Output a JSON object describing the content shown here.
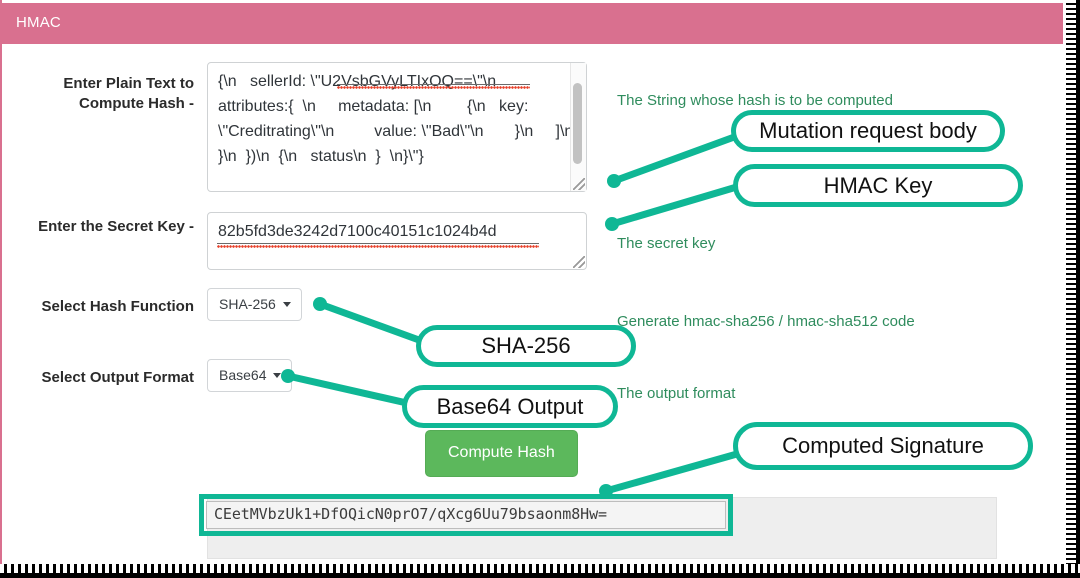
{
  "header": {
    "title": "HMAC"
  },
  "form": {
    "plaintext_label": "Enter Plain Text to Compute Hash -",
    "plaintext_value": "{\\n   sellerId: \\\"U2VsbGVyLTIxOQ==\\\"\\n   attributes:{  \\n     metadata: [\\n        {\\n   key: \\\"Creditrating\\\"\\n         value: \\\"Bad\\\"\\n       }\\n     ]\\n    }\\n  })\\n  {\\n   status\\n  }  \\n}\\\"}",
    "secret_label": "Enter the Secret Key -",
    "secret_value": "82b5fd3de3242d7100c40151c1024b4d",
    "hash_function_label": "Select Hash Function",
    "hash_function_value": "SHA-256",
    "output_format_label": "Select Output Format",
    "output_format_value": "Base64",
    "compute_button": "Compute Hash"
  },
  "result": {
    "hash": "CEetMVbzUk1+DfOQicN0prO7/qXcg6Uu79bsaonm8Hw="
  },
  "notes": {
    "string": "The String whose hash is to be computed",
    "secret": "The secret key",
    "generate": "Generate hmac-sha256 / hmac-sha512 code",
    "format": "The output format"
  },
  "callouts": {
    "mutation": "Mutation request body",
    "hmac_key": "HMAC Key",
    "sha256": "SHA-256",
    "base64": "Base64 Output",
    "signature": "Computed Signature"
  },
  "colors": {
    "header_pink": "#d9708f",
    "annotation_teal": "#0fb795",
    "button_green": "#5cb85c",
    "note_green": "#2f8c5d"
  }
}
